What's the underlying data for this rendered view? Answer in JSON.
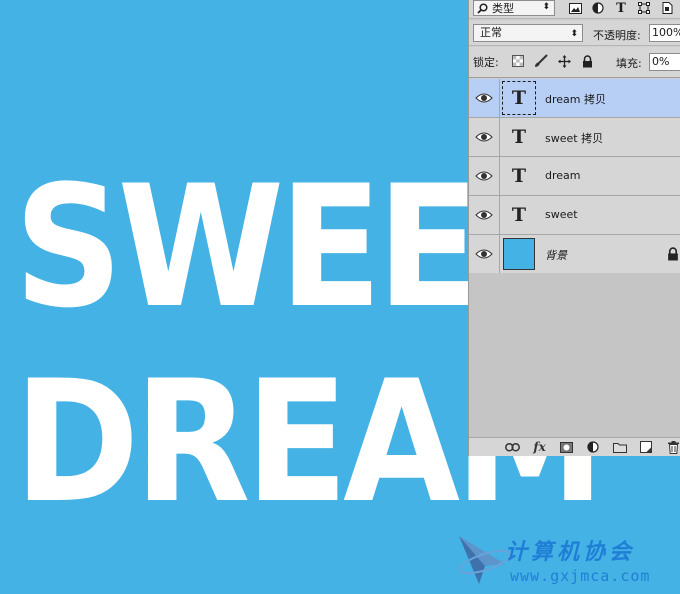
{
  "canvas": {
    "background_color": "#44b2e5",
    "text_color": "#ffffff",
    "line1": "SWEET",
    "line2": "DREAM"
  },
  "watermark": {
    "title": "计算机协会",
    "url": "www.gxjmca.com",
    "color": "#1f7fd6"
  },
  "layers_panel": {
    "filter": {
      "icon": "search-icon",
      "value": "类型"
    },
    "filter_icons": [
      "image-filter-icon",
      "adjustment-filter-icon",
      "text-filter-icon",
      "shape-filter-icon",
      "smart-object-filter-icon"
    ],
    "blend_mode": "正常",
    "opacity_label": "不透明度:",
    "opacity_value": "100%",
    "lock_label": "锁定:",
    "lock_icons": [
      "lock-transparent-icon",
      "lock-paint-icon",
      "lock-move-icon",
      "lock-all-icon"
    ],
    "fill_label": "填充:",
    "fill_value": "0%",
    "layers": [
      {
        "name": "dream 拷贝",
        "type": "text",
        "selected": true,
        "visible": true
      },
      {
        "name": "sweet 拷贝",
        "type": "text",
        "selected": false,
        "visible": true
      },
      {
        "name": "dream",
        "type": "text",
        "selected": false,
        "visible": true
      },
      {
        "name": "sweet",
        "type": "text",
        "selected": false,
        "visible": true
      },
      {
        "name": "背景",
        "type": "background",
        "selected": false,
        "visible": true,
        "locked": true
      }
    ],
    "bottom_icons": [
      "link-layers-icon",
      "fx-icon",
      "add-mask-icon",
      "adjustment-layer-icon",
      "new-group-icon",
      "new-layer-icon",
      "delete-icon"
    ],
    "text_thumbnail_glyph": "T",
    "fx_label": "fx",
    "selected_color": "#b7cff5"
  }
}
